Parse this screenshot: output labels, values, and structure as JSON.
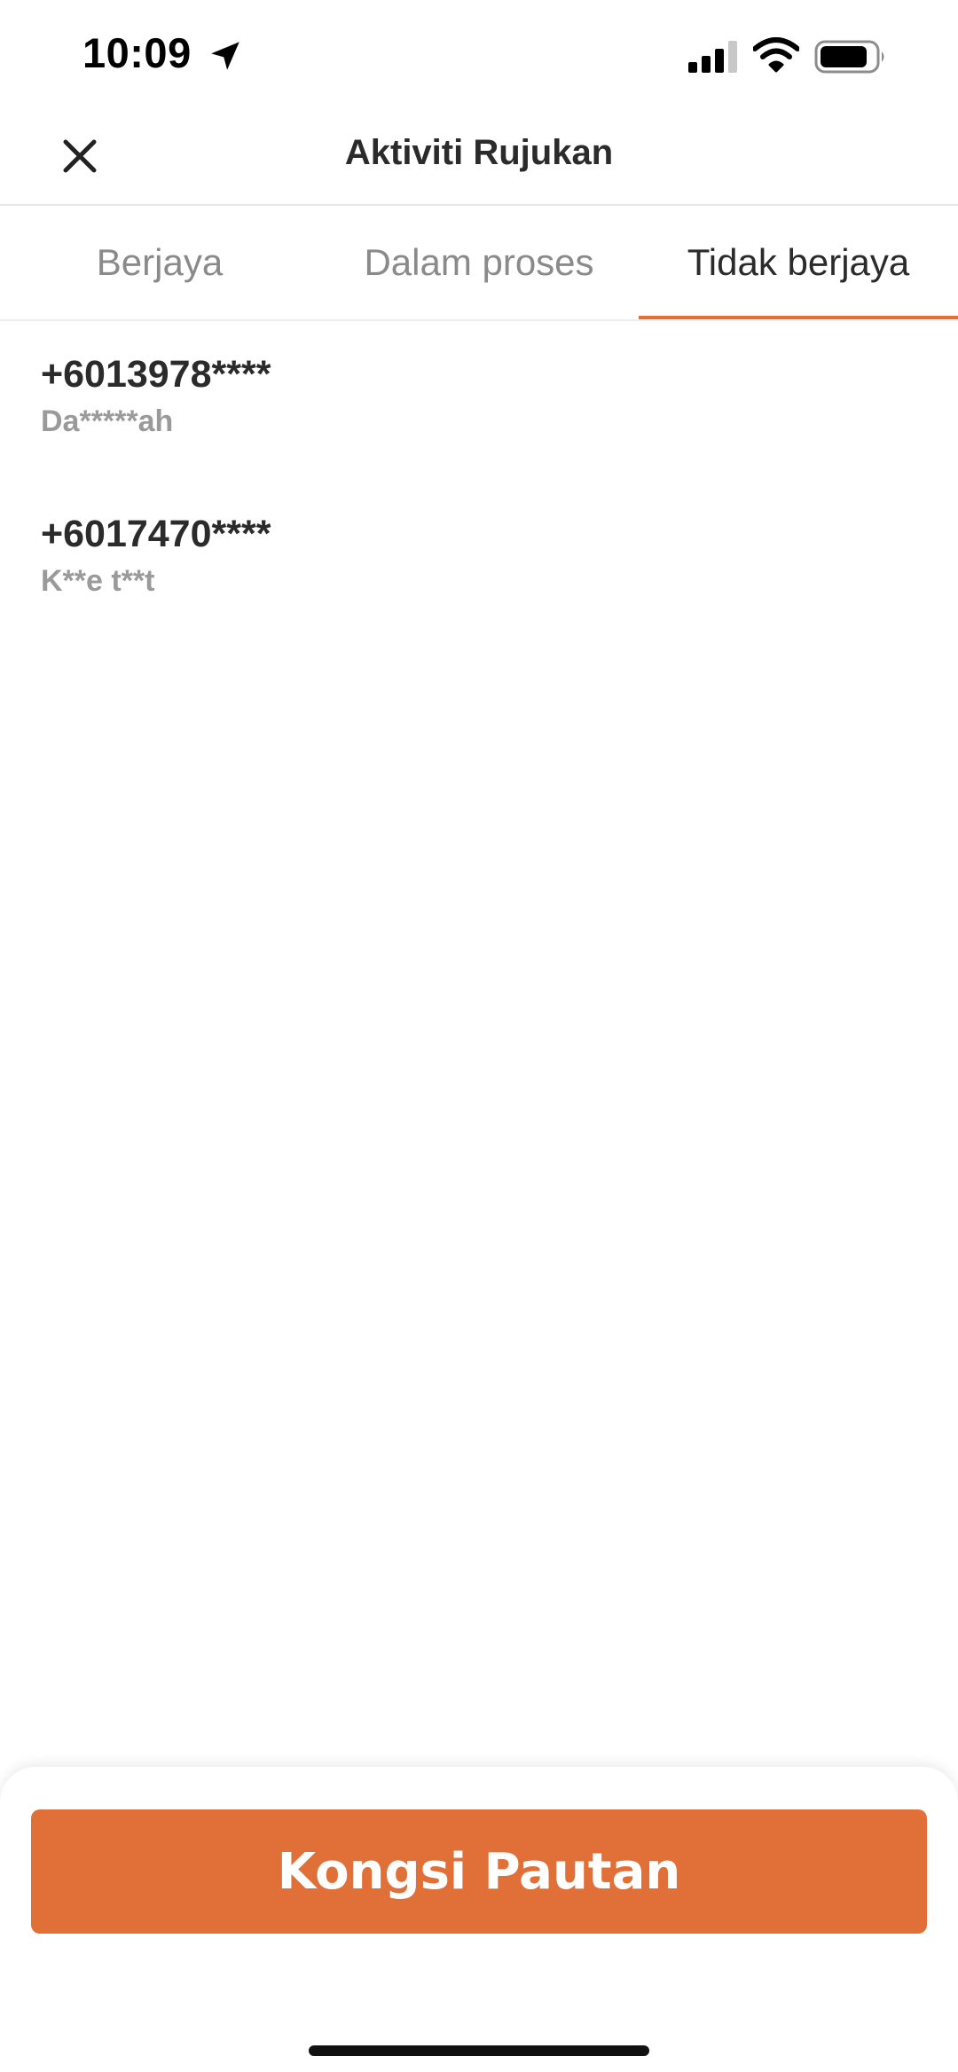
{
  "status_bar": {
    "time": "10:09",
    "icons": [
      "location-arrow-icon",
      "cellular-signal-icon",
      "wifi-icon",
      "battery-icon"
    ]
  },
  "header": {
    "title": "Aktiviti Rujukan",
    "close_icon": "close-icon"
  },
  "tabs": [
    {
      "label": "Berjaya",
      "active": false
    },
    {
      "label": "Dalam proses",
      "active": false
    },
    {
      "label": "Tidak berjaya",
      "active": true
    }
  ],
  "referrals": [
    {
      "phone": "+6013978****",
      "name": "Da*****ah"
    },
    {
      "phone": "+6017470****",
      "name": "K**e t**t"
    }
  ],
  "footer": {
    "share_button_label": "Kongsi Pautan"
  },
  "colors": {
    "accent": "#e07038",
    "text_primary": "#2b2b2b",
    "text_secondary": "#8a8a8a"
  }
}
